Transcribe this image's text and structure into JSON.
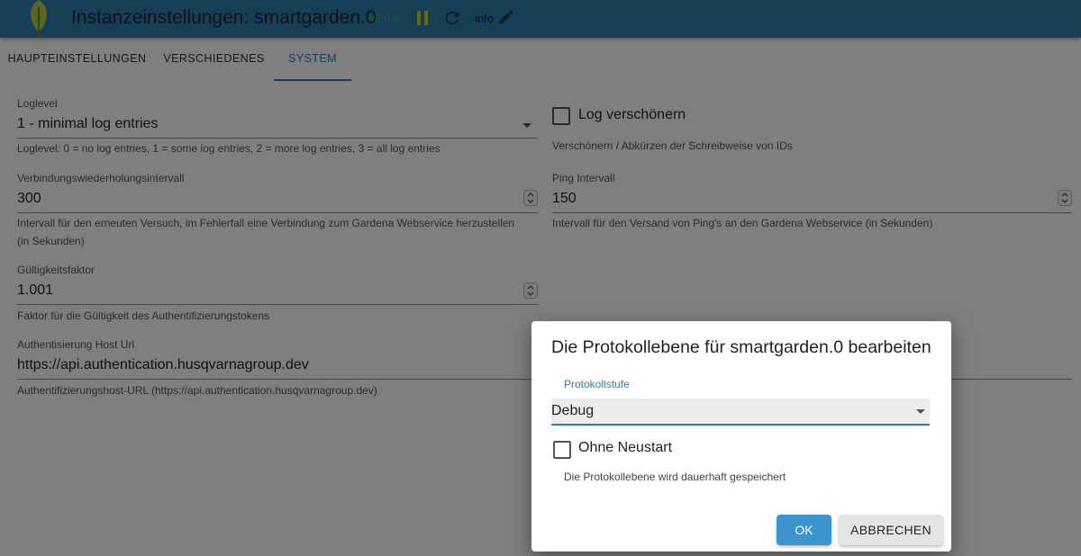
{
  "header": {
    "title": "Instanzeinstellungen: smartgarden.0",
    "version": "v2.0.0",
    "info_label": "info"
  },
  "tabs": [
    {
      "label": "HAUPTEINSTELLUNGEN",
      "active": false
    },
    {
      "label": "VERSCHIEDENES",
      "active": false
    },
    {
      "label": "SYSTEM",
      "active": true
    }
  ],
  "form": {
    "loglevel": {
      "label": "Loglevel",
      "value": "1 - minimal log entries",
      "helper": "Loglevel: 0 = no log entries, 1 = some log entries, 2 = more log entries, 3 = all log entries"
    },
    "log_beautify": {
      "label": "Log verschönern",
      "checked": false,
      "helper": "Verschönern / Abkürzen der Schreibweise von IDs"
    },
    "retry_interval": {
      "label": "Verbindungswiederholungsintervall",
      "value": "300",
      "helper_line1": "Intervall für den erneuten Versuch, im Fehlerfall eine Verbindung zum Gardena Webservice herzustellen",
      "helper_line2": "(in Sekunden)"
    },
    "ping_interval": {
      "label": "Ping Intervall",
      "value": "150",
      "helper": "Intervall für den Versand von Ping's an den Gardena Webservice (in Sekunden)"
    },
    "validity_factor": {
      "label": "Gültigkeitsfaktor",
      "value": "1.001",
      "helper": "Faktor für die Gültigkeit des Authentifizierungstokens"
    },
    "auth_host": {
      "label": "Authentisierung Host Url",
      "value": "https://api.authentication.husqvarnagroup.dev",
      "helper": "Authentifizierungshost-URL (https://api.authentication.husqvarnagroup.dev)"
    }
  },
  "dialog": {
    "title": "Die Protokollebene für smartgarden.0 bearbeiten",
    "select_label": "Protokollstufe",
    "select_value": "Debug",
    "checkbox_label": "Ohne Neustart",
    "checkbox_checked": false,
    "helper": "Die Protokollebene wird dauerhaft gespeichert",
    "ok_label": "OK",
    "cancel_label": "ABBRECHEN"
  },
  "colors": {
    "header_bg": "#2d7fae",
    "accent": "#2d7fae",
    "ok_button": "#3b95cc",
    "version_text": "#4caf50",
    "pause_icon": "#c9d400"
  },
  "icons": [
    "leaf-logo-icon",
    "pause-icon",
    "reload-icon",
    "edit-pencil-icon",
    "dropdown-arrow-icon",
    "spinner-arrows-icon",
    "checkbox-icon"
  ]
}
